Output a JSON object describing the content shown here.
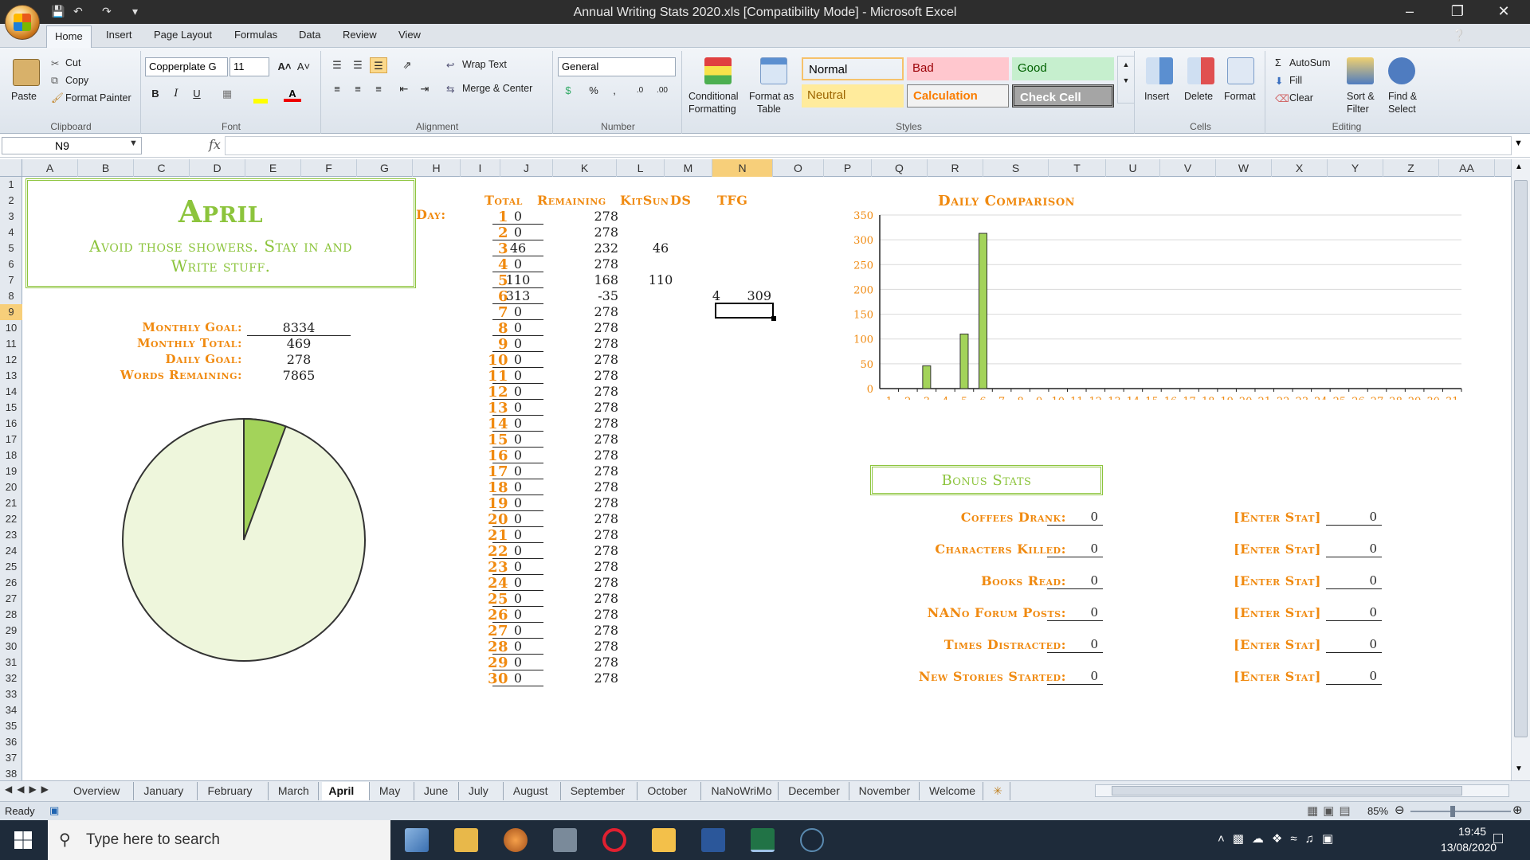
{
  "window": {
    "title": "Annual Writing Stats 2020.xls  [Compatibility Mode] - Microsoft Excel",
    "controls": [
      "minimize",
      "restore",
      "close"
    ]
  },
  "ribbon_tabs": [
    "Home",
    "Insert",
    "Page Layout",
    "Formulas",
    "Data",
    "Review",
    "View"
  ],
  "ribbon": {
    "clipboard": {
      "label": "Clipboard",
      "paste": "Paste",
      "cut": "Cut",
      "copy": "Copy",
      "format_painter": "Format Painter"
    },
    "font": {
      "label": "Font",
      "name": "Copperplate G",
      "size": "11"
    },
    "alignment": {
      "label": "Alignment",
      "wrap_text": "Wrap Text",
      "merge_center": "Merge & Center"
    },
    "number": {
      "label": "Number",
      "format": "General"
    },
    "styles": {
      "label": "Styles",
      "conditional": "Conditional",
      "formatting": "Formatting",
      "format_as": "Format as",
      "table": "Table",
      "cells": [
        {
          "name": "Normal",
          "bg": "#ffffff",
          "fg": "#000000"
        },
        {
          "name": "Bad",
          "bg": "#ffc7ce",
          "fg": "#9c0006"
        },
        {
          "name": "Good",
          "bg": "#c6efce",
          "fg": "#006100"
        },
        {
          "name": "Neutral",
          "bg": "#ffeb9c",
          "fg": "#9c6500"
        },
        {
          "name": "Calculation",
          "bg": "#f2f2f2",
          "fg": "#fa7d00"
        },
        {
          "name": "Check Cell",
          "bg": "#a5a5a5",
          "fg": "#ffffff"
        }
      ]
    },
    "cells_group": {
      "label": "Cells",
      "insert": "Insert",
      "delete": "Delete",
      "format": "Format"
    },
    "editing": {
      "label": "Editing",
      "autosum": "AutoSum",
      "fill": "Fill",
      "clear": "Clear",
      "sort_filter_1": "Sort &",
      "sort_filter_2": "Filter",
      "find_select_1": "Find &",
      "find_select_2": "Select"
    }
  },
  "formula_bar": {
    "name_box": "N9",
    "fx": "fx",
    "formula": ""
  },
  "columns": [
    "A",
    "B",
    "C",
    "D",
    "E",
    "F",
    "G",
    "H",
    "I",
    "J",
    "K",
    "L",
    "M",
    "N",
    "O",
    "P",
    "Q",
    "R",
    "S",
    "T",
    "U",
    "V",
    "W",
    "X",
    "Y",
    "Z",
    "AA"
  ],
  "rows": [
    "1",
    "2",
    "3",
    "4",
    "5",
    "6",
    "7",
    "8",
    "9",
    "10",
    "11",
    "12",
    "13",
    "14",
    "15",
    "16",
    "17",
    "18",
    "19",
    "20",
    "21",
    "22",
    "23",
    "24",
    "25",
    "26",
    "27",
    "28",
    "29",
    "30",
    "31",
    "32",
    "33",
    "34",
    "35",
    "36",
    "37",
    "38"
  ],
  "selected_cell": {
    "column": "N",
    "row": "9"
  },
  "sheet": {
    "banner_title": "April",
    "banner_subtitle_1": "Avoid those showers. Stay in and",
    "banner_subtitle_2": "Write stuff.",
    "summary": [
      {
        "label": "Monthly Goal:",
        "value": "8334"
      },
      {
        "label": "Monthly Total:",
        "value": "469"
      },
      {
        "label": "Daily Goal:",
        "value": "278"
      },
      {
        "label": "Words Remaining:",
        "value": "7865"
      }
    ],
    "pie": {
      "written": 469,
      "remaining": 7865
    },
    "table_headers": {
      "day": "Day:",
      "total": "Total",
      "remaining": "Remaining",
      "kitsun": "KitSun",
      "ds": "DS",
      "tfg": "TFG"
    },
    "days": [
      {
        "day": "1",
        "total": "0",
        "remaining": "278",
        "kitsun": "",
        "ds": "",
        "tfg": ""
      },
      {
        "day": "2",
        "total": "0",
        "remaining": "278",
        "kitsun": "",
        "ds": "",
        "tfg": ""
      },
      {
        "day": "3",
        "total": "46",
        "remaining": "232",
        "kitsun": "46",
        "ds": "",
        "tfg": ""
      },
      {
        "day": "4",
        "total": "0",
        "remaining": "278",
        "kitsun": "",
        "ds": "",
        "tfg": ""
      },
      {
        "day": "5",
        "total": "110",
        "remaining": "168",
        "kitsun": "110",
        "ds": "",
        "tfg": ""
      },
      {
        "day": "6",
        "total": "313",
        "remaining": "-35",
        "kitsun": "",
        "ds": "4",
        "tfg": "309"
      },
      {
        "day": "7",
        "total": "0",
        "remaining": "278",
        "kitsun": "",
        "ds": "",
        "tfg": ""
      },
      {
        "day": "8",
        "total": "0",
        "remaining": "278",
        "kitsun": "",
        "ds": "",
        "tfg": ""
      },
      {
        "day": "9",
        "total": "0",
        "remaining": "278",
        "kitsun": "",
        "ds": "",
        "tfg": ""
      },
      {
        "day": "10",
        "total": "0",
        "remaining": "278",
        "kitsun": "",
        "ds": "",
        "tfg": ""
      },
      {
        "day": "11",
        "total": "0",
        "remaining": "278",
        "kitsun": "",
        "ds": "",
        "tfg": ""
      },
      {
        "day": "12",
        "total": "0",
        "remaining": "278",
        "kitsun": "",
        "ds": "",
        "tfg": ""
      },
      {
        "day": "13",
        "total": "0",
        "remaining": "278",
        "kitsun": "",
        "ds": "",
        "tfg": ""
      },
      {
        "day": "14",
        "total": "0",
        "remaining": "278",
        "kitsun": "",
        "ds": "",
        "tfg": ""
      },
      {
        "day": "15",
        "total": "0",
        "remaining": "278",
        "kitsun": "",
        "ds": "",
        "tfg": ""
      },
      {
        "day": "16",
        "total": "0",
        "remaining": "278",
        "kitsun": "",
        "ds": "",
        "tfg": ""
      },
      {
        "day": "17",
        "total": "0",
        "remaining": "278",
        "kitsun": "",
        "ds": "",
        "tfg": ""
      },
      {
        "day": "18",
        "total": "0",
        "remaining": "278",
        "kitsun": "",
        "ds": "",
        "tfg": ""
      },
      {
        "day": "19",
        "total": "0",
        "remaining": "278",
        "kitsun": "",
        "ds": "",
        "tfg": ""
      },
      {
        "day": "20",
        "total": "0",
        "remaining": "278",
        "kitsun": "",
        "ds": "",
        "tfg": ""
      },
      {
        "day": "21",
        "total": "0",
        "remaining": "278",
        "kitsun": "",
        "ds": "",
        "tfg": ""
      },
      {
        "day": "22",
        "total": "0",
        "remaining": "278",
        "kitsun": "",
        "ds": "",
        "tfg": ""
      },
      {
        "day": "23",
        "total": "0",
        "remaining": "278",
        "kitsun": "",
        "ds": "",
        "tfg": ""
      },
      {
        "day": "24",
        "total": "0",
        "remaining": "278",
        "kitsun": "",
        "ds": "",
        "tfg": ""
      },
      {
        "day": "25",
        "total": "0",
        "remaining": "278",
        "kitsun": "",
        "ds": "",
        "tfg": ""
      },
      {
        "day": "26",
        "total": "0",
        "remaining": "278",
        "kitsun": "",
        "ds": "",
        "tfg": ""
      },
      {
        "day": "27",
        "total": "0",
        "remaining": "278",
        "kitsun": "",
        "ds": "",
        "tfg": ""
      },
      {
        "day": "28",
        "total": "0",
        "remaining": "278",
        "kitsun": "",
        "ds": "",
        "tfg": ""
      },
      {
        "day": "29",
        "total": "0",
        "remaining": "278",
        "kitsun": "",
        "ds": "",
        "tfg": ""
      },
      {
        "day": "30",
        "total": "0",
        "remaining": "278",
        "kitsun": "",
        "ds": "",
        "tfg": ""
      }
    ],
    "bonus_title": "Bonus Stats",
    "bonus_left": [
      {
        "label": "Coffees Drank:",
        "value": "0"
      },
      {
        "label": "Characters Killed:",
        "value": "0"
      },
      {
        "label": "Books Read:",
        "value": "0"
      },
      {
        "label": "NANo Forum Posts:",
        "value": "0"
      },
      {
        "label": "Times Distracted:",
        "value": "0"
      },
      {
        "label": "New Stories Started:",
        "value": "0"
      }
    ],
    "bonus_right": [
      {
        "label": "[Enter Stat]",
        "value": "0"
      },
      {
        "label": "[Enter Stat]",
        "value": "0"
      },
      {
        "label": "[Enter Stat]",
        "value": "0"
      },
      {
        "label": "[Enter Stat]",
        "value": "0"
      },
      {
        "label": "[Enter Stat]",
        "value": "0"
      },
      {
        "label": "[Enter Stat]",
        "value": "0"
      }
    ],
    "colors": {
      "accent_orange": "#f08a10",
      "accent_green": "#8cc43c",
      "pie_fill": "#eef6dc",
      "pie_slice": "#a3d35a"
    }
  },
  "chart_data": {
    "type": "bar",
    "title": "Daily Comparison",
    "categories": [
      "1",
      "2",
      "3",
      "4",
      "5",
      "6",
      "7",
      "8",
      "9",
      "10",
      "11",
      "12",
      "13",
      "14",
      "15",
      "16",
      "17",
      "18",
      "19",
      "20",
      "21",
      "22",
      "23",
      "24",
      "25",
      "26",
      "27",
      "28",
      "29",
      "30",
      "31"
    ],
    "values": [
      0,
      0,
      46,
      0,
      110,
      313,
      0,
      0,
      0,
      0,
      0,
      0,
      0,
      0,
      0,
      0,
      0,
      0,
      0,
      0,
      0,
      0,
      0,
      0,
      0,
      0,
      0,
      0,
      0,
      0,
      0
    ],
    "ylim": [
      0,
      350
    ],
    "yticks": [
      "0",
      "50",
      "100",
      "150",
      "200",
      "250",
      "300",
      "350"
    ],
    "grid": true,
    "legend": "none"
  },
  "sheet_tabs": [
    "Overview",
    "January",
    "February",
    "March",
    "April",
    "May",
    "June",
    "July",
    "August",
    "September",
    "October",
    "NaNoWriMo",
    "December",
    "November",
    "Welcome"
  ],
  "active_sheet": "April",
  "status": {
    "ready": "Ready",
    "zoom": "85%"
  },
  "taskbar": {
    "search_placeholder": "Type here to search",
    "time": "19:45",
    "date": "13/08/2020"
  }
}
